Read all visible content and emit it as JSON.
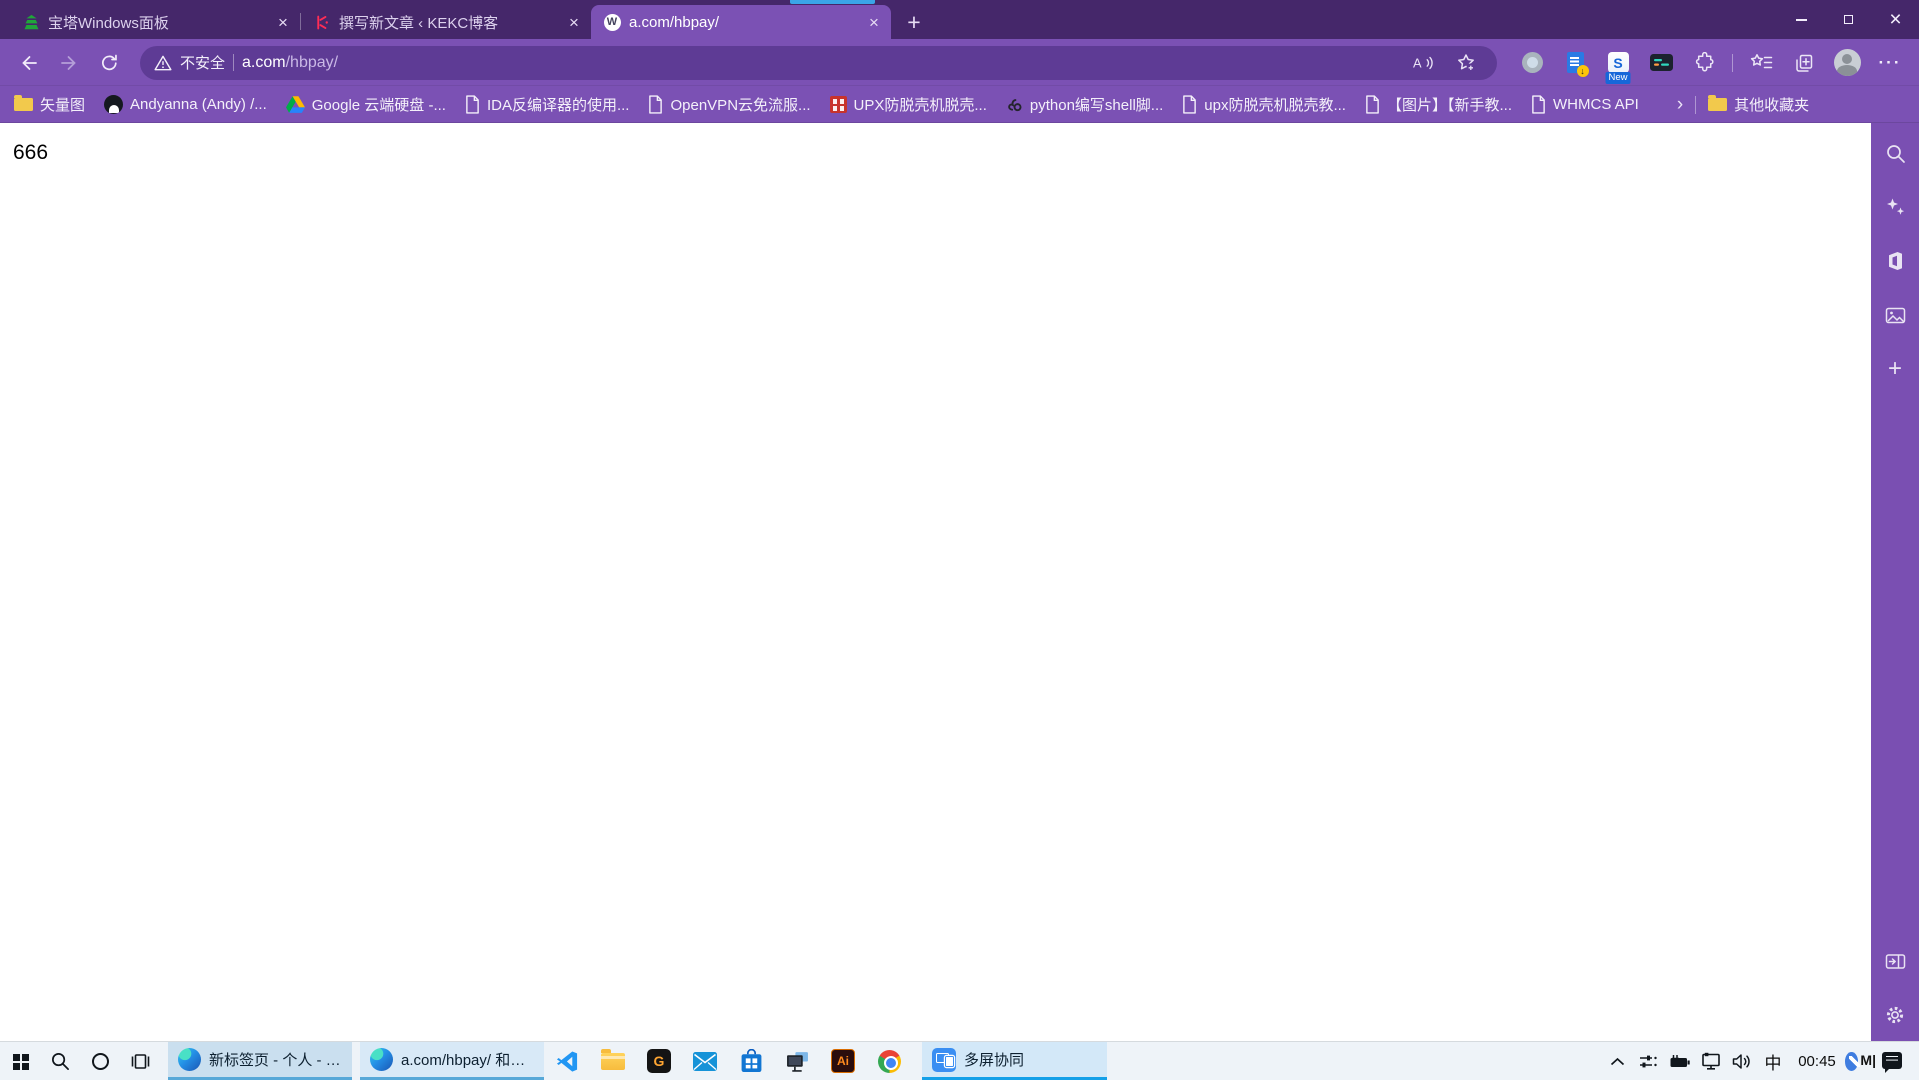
{
  "theme": {
    "titlebar": "#45276a",
    "toolbar": "#7b51b4",
    "address_field": "#5e3b95",
    "edge_sidebar": "#7a4fb2",
    "tab_loading_accent": "#3aa5e8",
    "taskbar": "#eef3f8",
    "taskbar_active_underline": "#14a0e8",
    "page_background": "#ffffff"
  },
  "browser": {
    "tabs": [
      {
        "title": "宝塔Windows面板",
        "icon": "baota-panel-icon",
        "active": false
      },
      {
        "title": "撰写新文章 ‹ KEKC博客",
        "icon": "kekc-blog-icon",
        "active": false
      },
      {
        "title": "a.com/hbpay/",
        "icon": "wordpress-icon",
        "active": true
      }
    ],
    "toolbar": {
      "security_label": "不安全",
      "url_host": "a.com",
      "url_path": "/hbpay/",
      "extension_new_badge": "New"
    },
    "bookmarks_bar": {
      "items": [
        {
          "label": "矢量图",
          "icon": "folder-icon"
        },
        {
          "label": "Andyanna (Andy) /...",
          "icon": "github-icon"
        },
        {
          "label": "Google 云端硬盘 -...",
          "icon": "google-drive-icon"
        },
        {
          "label": "IDA反编译器的使用...",
          "icon": "document-icon"
        },
        {
          "label": "OpenVPN云免流服...",
          "icon": "document-icon"
        },
        {
          "label": "UPX防脱壳机脱壳...",
          "icon": "red-seal-icon"
        },
        {
          "label": "python编写shell脚...",
          "icon": "script-site-icon"
        },
        {
          "label": "upx防脱壳机脱壳教...",
          "icon": "document-icon"
        },
        {
          "label": "【图片】【新手教...",
          "icon": "document-icon"
        },
        {
          "label": "WHMCS API",
          "icon": "document-icon"
        }
      ],
      "overflow_label": "其他收藏夹"
    },
    "page": {
      "body_text": "666"
    }
  },
  "taskbar": {
    "windows": [
      {
        "label": "新标签页 - 个人 - Mi...",
        "icon": "edge-icon"
      },
      {
        "label": "a.com/hbpay/ 和另...",
        "icon": "edge-icon"
      },
      {
        "label": "多屏协同",
        "icon": "multi-screen-icon"
      }
    ],
    "tray": {
      "ime_label": "中",
      "time": "00:45"
    }
  }
}
